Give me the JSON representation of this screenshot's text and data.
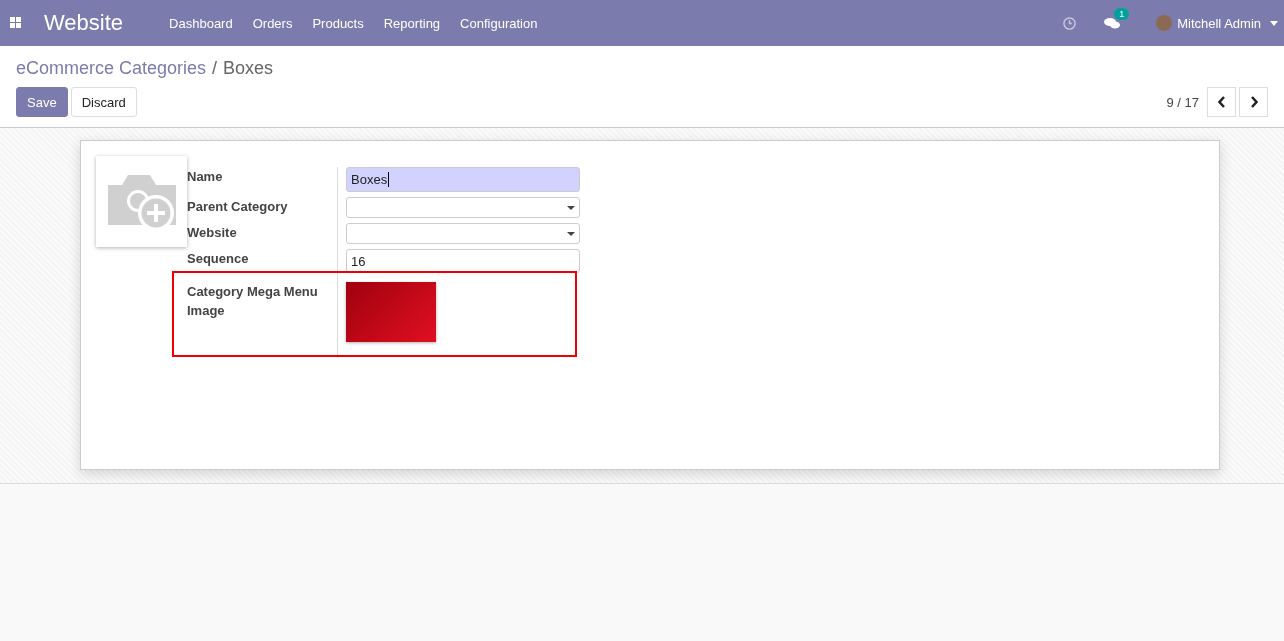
{
  "navbar": {
    "app_title": "Website",
    "menu": [
      "Dashboard",
      "Orders",
      "Products",
      "Reporting",
      "Configuration"
    ],
    "chat_badge": "1",
    "user": "Mitchell Admin"
  },
  "breadcrumb": {
    "parent": "eCommerce Categories",
    "separator": "/",
    "current": "Boxes"
  },
  "buttons": [
    {
      "label": "Save",
      "kind": "primary"
    },
    {
      "label": "Discard",
      "kind": "secondary"
    }
  ],
  "pager": {
    "value": "9 / 17"
  },
  "form": {
    "fields": [
      {
        "label": "Name",
        "kind": "input",
        "value": "Boxes",
        "focused": true
      },
      {
        "label": "Parent Category",
        "kind": "select"
      },
      {
        "label": "Website",
        "kind": "select"
      },
      {
        "label": "Sequence",
        "kind": "input",
        "value": "16",
        "focused": false
      },
      {
        "label": "Category Mega Menu Image",
        "kind": "image",
        "highlighted": true
      }
    ]
  }
}
